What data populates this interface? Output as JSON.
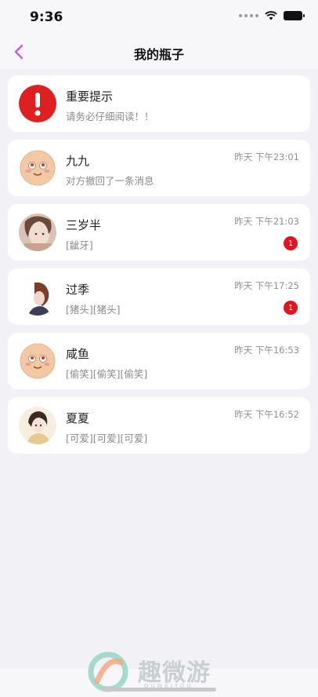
{
  "status_bar": {
    "time": "9:36"
  },
  "nav": {
    "title": "我的瓶子"
  },
  "conversations": [
    {
      "name": "重要提示",
      "preview": "请务必仔细阅读！！",
      "time": "",
      "badge": "",
      "avatar": "alert-icon"
    },
    {
      "name": "九九",
      "preview": "对方撤回了一条消息",
      "time": "昨天 下午23:01",
      "badge": "",
      "avatar": "emoji-face"
    },
    {
      "name": "三岁半",
      "preview": "[龇牙]",
      "time": "昨天 下午21:03",
      "badge": "1",
      "avatar": "photo"
    },
    {
      "name": "过季",
      "preview": "[猪头][猪头]",
      "time": "昨天 下午17:25",
      "badge": "1",
      "avatar": "photo"
    },
    {
      "name": "咸鱼",
      "preview": "[偷笑][偷笑][偷笑]",
      "time": "昨天 下午16:53",
      "badge": "",
      "avatar": "emoji-face"
    },
    {
      "name": "夏夏",
      "preview": "[可爱][可爱][可爱]",
      "time": "昨天 下午16:52",
      "badge": "",
      "avatar": "photo"
    }
  ],
  "watermark": {
    "text": "趣微游",
    "sub": "QUWEIYOU"
  },
  "colors": {
    "accent": "#c15cf0",
    "badge": "#e5131f",
    "alert": "#e02020"
  }
}
